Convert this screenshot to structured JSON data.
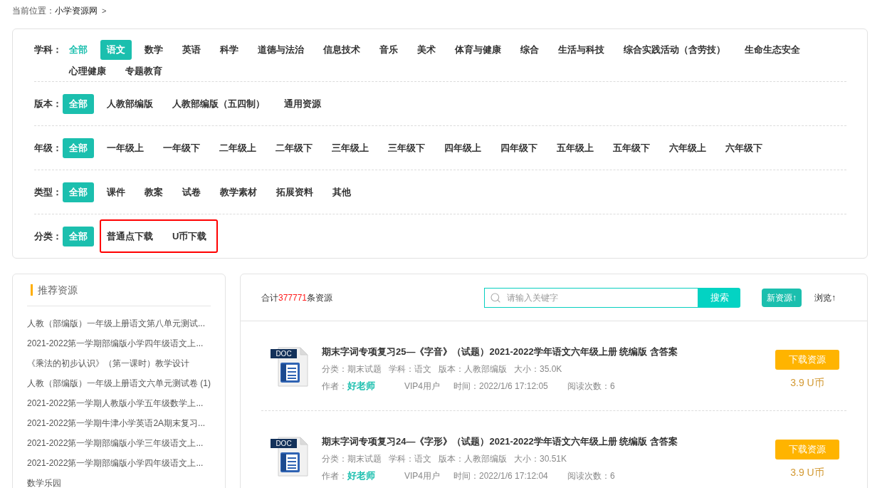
{
  "breadcrumb": {
    "label": "当前位置：",
    "items": [
      {
        "text": "小学资源网"
      }
    ],
    "separator": ">"
  },
  "filters": [
    {
      "label": "学科：",
      "options": [
        {
          "text": "全部",
          "selected": false,
          "highlighted": true
        },
        {
          "text": "语文",
          "selected": true,
          "highlighted": false
        },
        {
          "text": "数学",
          "selected": false,
          "highlighted": false
        },
        {
          "text": "英语",
          "selected": false,
          "highlighted": false
        },
        {
          "text": "科学",
          "selected": false,
          "highlighted": false
        },
        {
          "text": "道德与法治",
          "selected": false,
          "highlighted": false
        },
        {
          "text": "信息技术",
          "selected": false,
          "highlighted": false
        },
        {
          "text": "音乐",
          "selected": false,
          "highlighted": false
        },
        {
          "text": "美术",
          "selected": false,
          "highlighted": false
        },
        {
          "text": "体育与健康",
          "selected": false,
          "highlighted": false
        },
        {
          "text": "综合",
          "selected": false,
          "highlighted": false
        },
        {
          "text": "生活与科技",
          "selected": false,
          "highlighted": false
        },
        {
          "text": "综合实践活动（含劳技）",
          "selected": false,
          "highlighted": false
        },
        {
          "text": "生命生态安全",
          "selected": false,
          "highlighted": false
        },
        {
          "text": "心理健康",
          "selected": false,
          "highlighted": false
        },
        {
          "text": "专题教育",
          "selected": false,
          "highlighted": false
        }
      ]
    },
    {
      "label": "版本：",
      "options": [
        {
          "text": "全部",
          "selected": true
        },
        {
          "text": "人教部编版",
          "selected": false
        },
        {
          "text": "人教部编版（五四制）",
          "selected": false
        },
        {
          "text": "通用资源",
          "selected": false
        }
      ]
    },
    {
      "label": "年级：",
      "options": [
        {
          "text": "全部",
          "selected": true
        },
        {
          "text": "一年级上",
          "selected": false
        },
        {
          "text": "一年级下",
          "selected": false
        },
        {
          "text": "二年级上",
          "selected": false
        },
        {
          "text": "二年级下",
          "selected": false
        },
        {
          "text": "三年级上",
          "selected": false
        },
        {
          "text": "三年级下",
          "selected": false
        },
        {
          "text": "四年级上",
          "selected": false
        },
        {
          "text": "四年级下",
          "selected": false
        },
        {
          "text": "五年级上",
          "selected": false
        },
        {
          "text": "五年级下",
          "selected": false
        },
        {
          "text": "六年级上",
          "selected": false
        },
        {
          "text": "六年级下",
          "selected": false
        }
      ]
    },
    {
      "label": "类型：",
      "options": [
        {
          "text": "全部",
          "selected": true
        },
        {
          "text": "课件",
          "selected": false
        },
        {
          "text": "教案",
          "selected": false
        },
        {
          "text": "试卷",
          "selected": false
        },
        {
          "text": "教学素材",
          "selected": false
        },
        {
          "text": "拓展资料",
          "selected": false
        },
        {
          "text": "其他",
          "selected": false
        }
      ]
    },
    {
      "label": "分类：",
      "options": [
        {
          "text": "全部",
          "selected": true,
          "framed": false
        },
        {
          "text": "普通点下载",
          "selected": false,
          "framed": true
        },
        {
          "text": "U币下载",
          "selected": false,
          "framed": true
        }
      ]
    }
  ],
  "recommended": {
    "title": "推荐资源",
    "items": [
      "人教（部编版）一年级上册语文第八单元测试...",
      "2021-2022第一学期部编版小学四年级语文上...",
      "《乘法的初步认识》（第一课时）教学设计",
      "人教（部编版）一年级上册语文六单元测试卷 (1)",
      "2021-2022第一学期人教版小学五年级数学上...",
      "2021-2022第一学期牛津小学英语2A期末复习...",
      "2021-2022第一学期部编版小学三年级语文上...",
      "2021-2022第一学期部编版小学四年级语文上...",
      "数学乐园"
    ]
  },
  "results": {
    "total_prefix": "合计",
    "total": "377771",
    "total_suffix": "条资源",
    "search": {
      "placeholder": "请输入关键字",
      "button": "搜索"
    },
    "sorts": [
      {
        "label": "新资源↑",
        "selected": true
      },
      {
        "label": "浏览↑",
        "selected": false
      }
    ],
    "items": [
      {
        "file_type": "DOC",
        "title": "期末字词专项复习25—《字音》（试题）2021-2022学年语文六年级上册 统编版 含答案",
        "meta": [
          {
            "label": "分类：",
            "value": "期末试题"
          },
          {
            "label": "学科：",
            "value": "语文"
          },
          {
            "label": "版本：",
            "value": "人教部编版"
          },
          {
            "label": "大小：",
            "value": "35.0K"
          }
        ],
        "author_label": "作者：",
        "author": "好老师",
        "user_rank": "VIP4用户",
        "time_label": "时间：",
        "time": "2022/1/6 17:12:05",
        "views_label": "阅读次数：",
        "views": "6",
        "download": "下载资源",
        "price": "3.9 U币"
      },
      {
        "file_type": "DOC",
        "title": "期末字词专项复习24—《字形》（试题）2021-2022学年语文六年级上册 统编版 含答案",
        "meta": [
          {
            "label": "分类：",
            "value": "期末试题"
          },
          {
            "label": "学科：",
            "value": "语文"
          },
          {
            "label": "版本：",
            "value": "人教部编版"
          },
          {
            "label": "大小：",
            "value": "30.51K"
          }
        ],
        "author_label": "作者：",
        "author": "好老师",
        "user_rank": "VIP4用户",
        "time_label": "时间：",
        "time": "2022/1/6 17:12:04",
        "views_label": "阅读次数：",
        "views": "6",
        "download": "下载资源",
        "price": "3.9 U币"
      }
    ]
  }
}
